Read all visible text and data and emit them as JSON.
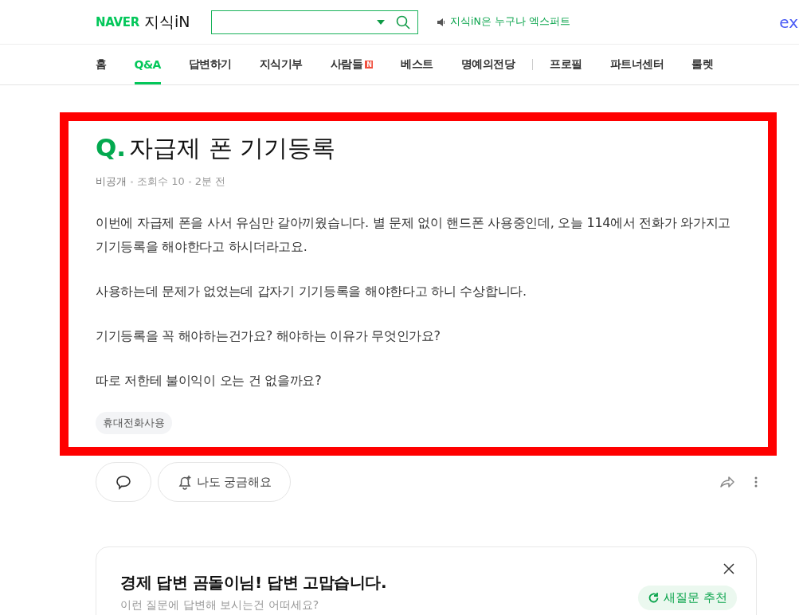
{
  "header": {
    "logo_brand": "NAVER",
    "logo_service": "지식iN",
    "notice": "지식iN은 누구나 엑스퍼트",
    "right_text": "ex"
  },
  "nav": [
    {
      "label": "홈",
      "selected": false
    },
    {
      "label": "Q&A",
      "selected": true
    },
    {
      "label": "답변하기",
      "selected": false
    },
    {
      "label": "지식기부",
      "selected": false
    },
    {
      "label": "사람들",
      "selected": false,
      "badge": "N"
    },
    {
      "label": "베스트",
      "selected": false
    },
    {
      "label": "명예의전당",
      "selected": false,
      "divider_after": true
    },
    {
      "label": "프로필",
      "selected": false
    },
    {
      "label": "파트너센터",
      "selected": false
    },
    {
      "label": "룰렛",
      "selected": false
    }
  ],
  "question": {
    "mark": "Q.",
    "title": "자급제 폰 기기등록",
    "meta": [
      "비공개",
      "조회수 10",
      "2분 전"
    ],
    "paragraphs": [
      "이번에 자급제 폰을 사서 유심만 갈아끼웠습니다. 별 문제 없이 핸드폰 사용중인데, 오늘 114에서 전화가 와가지고 기기등록을 해야한다고 하시더라고요.",
      "사용하는데 문제가 없었는데 갑자기 기기등록을 해야한다고 하니 수상합니다.",
      "기기등록을 꼭 해야하는건가요? 해야하는 이유가 무엇인가요?",
      "따로 저한테 불이익이 오는 건 없을까요?"
    ],
    "tags": [
      "휴대전화사용"
    ]
  },
  "actions": {
    "curious_label": "나도 궁금해요"
  },
  "promo": {
    "title": "경제 답변 곰돌이님! 답변 고맙습니다.",
    "subtitle": "이런 질문에 답변해 보시는건 어떠세요?",
    "button": "새질문 추천"
  }
}
